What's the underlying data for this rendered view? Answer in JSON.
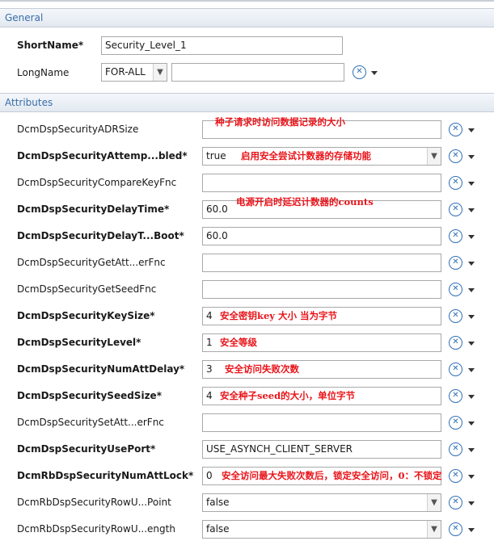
{
  "general": {
    "header": "General",
    "short_name_label": "ShortName*",
    "short_name_value": "Security_Level_1",
    "long_name_label": "LongName",
    "long_name_lang": "FOR-ALL",
    "long_name_value": ""
  },
  "attributes": {
    "header": "Attributes",
    "rows": [
      {
        "label": "DcmDspSecurityADRSize",
        "value": "",
        "note": "种子请求时访问数据记录的大小"
      },
      {
        "label": "DcmDspSecurityAttemp...bled*",
        "value": "true",
        "note": "启用安全尝试计数器的存储功能"
      },
      {
        "label": "DcmDspSecurityCompareKeyFnc",
        "value": "",
        "note": ""
      },
      {
        "label": "DcmDspSecurityDelayTime*",
        "value": "60.0",
        "note": "电源开启时延迟计数器的counts"
      },
      {
        "label": "DcmDspSecurityDelayT...Boot*",
        "value": "60.0",
        "note": ""
      },
      {
        "label": "DcmDspSecurityGetAtt...erFnc",
        "value": "",
        "note": ""
      },
      {
        "label": "DcmDspSecurityGetSeedFnc",
        "value": "",
        "note": ""
      },
      {
        "label": "DcmDspSecurityKeySize*",
        "value": "4",
        "note": "安全密钥key 大小 当为字节"
      },
      {
        "label": "DcmDspSecurityLevel*",
        "value": "1",
        "note": "安全等级"
      },
      {
        "label": "DcmDspSecurityNumAttDelay*",
        "value": "3",
        "note": "安全访问失败次数"
      },
      {
        "label": "DcmDspSecuritySeedSize*",
        "value": "4",
        "note": "安全种子seed的大小，单位字节"
      },
      {
        "label": "DcmDspSecuritySetAtt...erFnc",
        "value": "",
        "note": ""
      },
      {
        "label": "DcmDspSecurityUsePort*",
        "value": "USE_ASYNCH_CLIENT_SERVER",
        "note": ""
      },
      {
        "label": "DcmRbDspSecurityNumAttLock*",
        "value": "0",
        "note": "安全访问最大失败次数后，锁定安全访问，0：不锁定"
      },
      {
        "label": "DcmRbDspSecurityRowU...Point",
        "value": "false",
        "note": ""
      },
      {
        "label": "DcmRbDspSecurityRowU...ength",
        "value": "false",
        "note": ""
      }
    ]
  },
  "icons": {
    "reset": "reset-x-icon",
    "menu": "chevron-down-icon"
  },
  "colors": {
    "note": "#e8141a",
    "header_text": "#3a6ea8",
    "icon": "#2f6fb5"
  }
}
